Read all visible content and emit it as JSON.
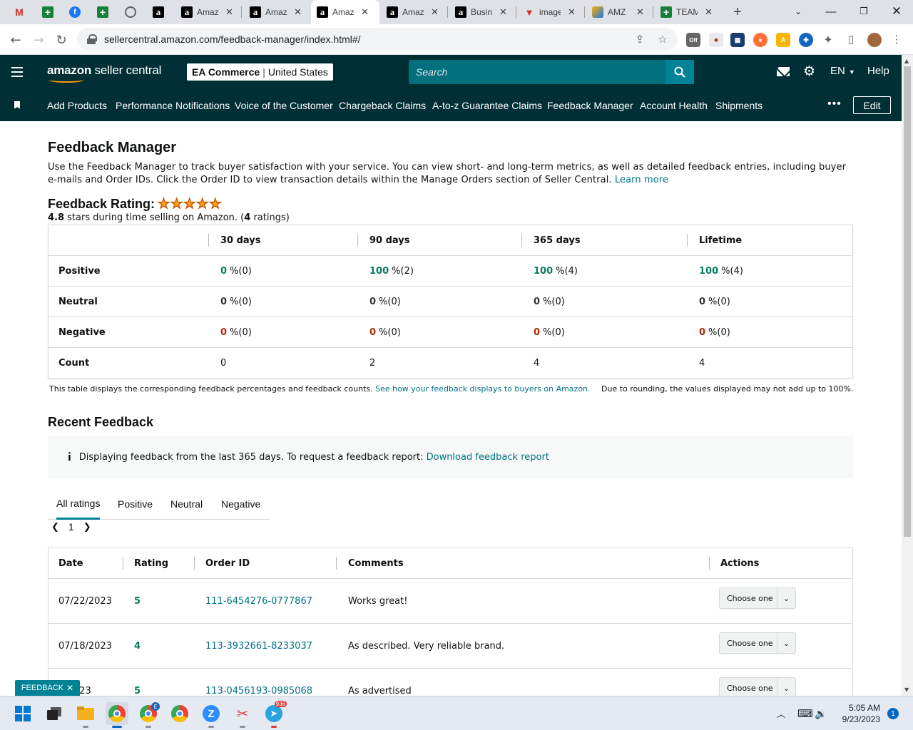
{
  "browser": {
    "tabs": [
      {
        "title": "",
        "icon": "gmail-icon"
      },
      {
        "title": "",
        "icon": "sheets-plus-icon"
      },
      {
        "title": "",
        "icon": "facebook-icon"
      },
      {
        "title": "",
        "icon": "sheets-plus-icon"
      },
      {
        "title": "",
        "icon": "globe-icon"
      },
      {
        "title": "",
        "icon": "amazon-icon"
      },
      {
        "title": "Amaz",
        "icon": "amazon-icon"
      },
      {
        "title": "Amaz",
        "icon": "amazon-icon"
      },
      {
        "title": "Amaz",
        "icon": "amazon-icon",
        "active": true
      },
      {
        "title": "Amaz",
        "icon": "amazon-icon"
      },
      {
        "title": "Busin",
        "icon": "amazon-icon"
      },
      {
        "title": "image",
        "icon": "image-icon"
      },
      {
        "title": "AMZ",
        "icon": "amz-icon"
      },
      {
        "title": "TEAM",
        "icon": "sheets-plus-icon"
      }
    ],
    "url": "sellercentral.amazon.com/feedback-manager/index.html#/",
    "ext_badge": "Off"
  },
  "header": {
    "logo_brand": "amazon",
    "logo_product": " seller central",
    "store_name": "EA Commerce",
    "store_sep": "|",
    "store_region": "United States",
    "search_placeholder": "Search",
    "lang": "EN",
    "help": "Help"
  },
  "nav": {
    "items": [
      "Add Products",
      "Performance Notifications",
      "Voice of the Customer",
      "Chargeback Claims",
      "A-to-z Guarantee Claims",
      "Feedback Manager",
      "Account Health",
      "Shipments"
    ],
    "edit": "Edit"
  },
  "page": {
    "title": "Feedback Manager",
    "intro": "Use the Feedback Manager to track buyer satisfaction with your service. You can view short- and long-term metrics, as well as detailed feedback entries, including buyer e-mails and Order IDs. Click the Order ID to view transaction details within the Manage Orders section of Seller Central.",
    "learn_more": "Learn more",
    "rating_label": "Feedback Rating:",
    "stars_value": 5,
    "rating_value": "4.8",
    "rating_text": " stars during time selling on Amazon. (",
    "rating_count": "4",
    "rating_suffix": " ratings)"
  },
  "metrics": {
    "columns": [
      "30 days",
      "90 days",
      "365 days",
      "Lifetime"
    ],
    "rows": [
      {
        "label": "Positive",
        "type": "g",
        "values": [
          [
            "0",
            "%(0)"
          ],
          [
            "100",
            "%(2)"
          ],
          [
            "100",
            "%(4)"
          ],
          [
            "100",
            "%(4)"
          ]
        ]
      },
      {
        "label": "Neutral",
        "type": "n",
        "values": [
          [
            "0",
            "%(0)"
          ],
          [
            "0",
            "%(0)"
          ],
          [
            "0",
            "%(0)"
          ],
          [
            "0",
            "%(0)"
          ]
        ]
      },
      {
        "label": "Negative",
        "type": "r",
        "values": [
          [
            "0",
            "%(0)"
          ],
          [
            "0",
            "%(0)"
          ],
          [
            "0",
            "%(0)"
          ],
          [
            "0",
            "%(0)"
          ]
        ]
      },
      {
        "label": "Count",
        "type": "plain",
        "values": [
          [
            "0",
            ""
          ],
          [
            "2",
            ""
          ],
          [
            "4",
            ""
          ],
          [
            "4",
            ""
          ]
        ]
      }
    ],
    "note": "This table displays the corresponding feedback percentages and feedback counts.",
    "note_link": "See how your feedback displays to buyers on Amazon.",
    "rounding_note": "Due to rounding, the values displayed may not add up to 100%."
  },
  "recent": {
    "title": "Recent Feedback",
    "info_icon": "i",
    "info": "Displaying feedback from the last 365 days. To request a feedback report:",
    "info_link": "Download feedback report",
    "tabs": [
      "All ratings",
      "Positive",
      "Neutral",
      "Negative"
    ],
    "page": "1",
    "columns": [
      "Date",
      "Rating",
      "Order ID",
      "Comments",
      "Actions"
    ],
    "rows": [
      {
        "date": "07/22/2023",
        "rating": "5",
        "order_id": "111-6454276-0777867",
        "comment": "Works great!",
        "action": "Choose one"
      },
      {
        "date": "07/18/2023",
        "rating": "4",
        "order_id": "113-3932661-8233037",
        "comment": "As described. Very reliable brand.",
        "action": "Choose one"
      },
      {
        "date": "9/2023",
        "rating": "5",
        "order_id": "113-0456193-0985068",
        "comment": "As advertised",
        "action": "Choose one"
      }
    ]
  },
  "feedback_tab": "FEEDBACK",
  "taskbar": {
    "time": "5:05 AM",
    "date": "9/23/2023",
    "notifications": "1",
    "telegram_badge": "936",
    "edge_badge": "E"
  },
  "colors": {
    "header_bg": "#002f36",
    "search_bg": "#00707e",
    "link": "#007185",
    "positive": "#067d62",
    "negative": "#b12704"
  }
}
